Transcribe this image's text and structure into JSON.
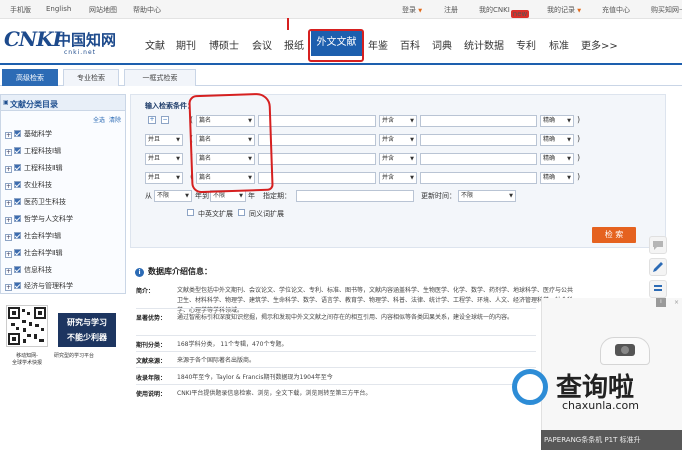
{
  "topbar": {
    "links": [
      "手机版",
      "English",
      "网站地图",
      "帮助中心"
    ],
    "right": {
      "login": "登录",
      "register": "注册",
      "my_cnki": "我的CNKI",
      "new": "new",
      "my_records": "我的记录",
      "recharge": "充值中心",
      "buy_card": "购买知网卡"
    }
  },
  "logo": {
    "main": "CNKI",
    "cn": "中国知网",
    "sub": "cnki.net"
  },
  "nav": [
    "文献",
    "期刊",
    "博硕士",
    "会议",
    "报纸",
    "外文文献",
    "年鉴",
    "百科",
    "词典",
    "统计数据",
    "专利",
    "标准",
    "更多>>"
  ],
  "tabs": [
    "高级检索",
    "专业检索",
    "一框式检索"
  ],
  "sidebar": {
    "title": "文献分类目录",
    "select_all": "全选",
    "clear": "清除",
    "categories": [
      "基础科学",
      "工程科技Ⅰ辑",
      "工程科技Ⅱ辑",
      "农业科技",
      "医药卫生科技",
      "哲学与人文科学",
      "社会科学Ⅰ辑",
      "社会科学Ⅱ辑",
      "信息科技",
      "经济与管理科学"
    ]
  },
  "search": {
    "input_label": "输入检索条件：",
    "rows": [
      {
        "logic": "",
        "field": "篇名",
        "op": "并含",
        "match": "精确"
      },
      {
        "logic": "并且",
        "field": "篇名",
        "op": "并含",
        "match": "精确"
      },
      {
        "logic": "并且",
        "field": "篇名",
        "op": "并含",
        "match": "精确"
      },
      {
        "logic": "并且",
        "field": "篇名",
        "op": "并含",
        "match": "精确"
      }
    ],
    "from": "从",
    "year_start": "不限",
    "year_to": "年到",
    "year_end": "不限",
    "year": "年",
    "specify_date": "指定期：",
    "update_time": "更新时间：",
    "update_value": "不限",
    "cn_expand": "中英文扩展",
    "synonym_expand": "同义词扩展",
    "search_button": "检 索"
  },
  "info": {
    "title": "数据库介绍信息：",
    "rows": [
      {
        "label": "简介：",
        "text": "文献类型包括中外文期刊、会议论文、学位论文、专利、标准、图书等，文献内容涵盖科学、生物医学、化学、数学、药剂学、地球科学、医疗与公共卫生、材料科学、物理学、建筑学、生命科学、数学、语言学、教育学、物理学、科普、法律、统计学、工程学、环境、人文、经济管理科学、社会科学、心理学等学科领域。"
      },
      {
        "label": "显著优势：",
        "text": "通过智能标引和深度知识挖掘，揭示和发现中外文文献之间存在的相互引用、内容相似等各类因果关系，建设全球统一的内容。"
      },
      {
        "label": "期刊分类：",
        "text": "168学科分类， 11个专辑，470个专题。"
      },
      {
        "label": "文献来源：",
        "text": "来源于各个国际著名出版商。"
      },
      {
        "label": "收录年限：",
        "text": "1840年至今，Taylor & Francis期刊数据现为1904年至今"
      },
      {
        "label": "使用说明：",
        "text": "CNKI平台提供题录信息检索、浏览，全文下载，浏览则转至第三方平台。"
      }
    ]
  },
  "promo": {
    "qr_label_1": "移动知网-",
    "qr_label_2": "全球学术快报",
    "banner_line1": "研究与学习",
    "banner_line2": "不能少利器",
    "banner_label": "研究型的学习平台"
  },
  "ad": {
    "close": "×",
    "info": "i",
    "watermark_text": "查询啦",
    "watermark_url": "chaxunla.com",
    "caption": "PAPERANG条条机 P1T 标准升"
  }
}
